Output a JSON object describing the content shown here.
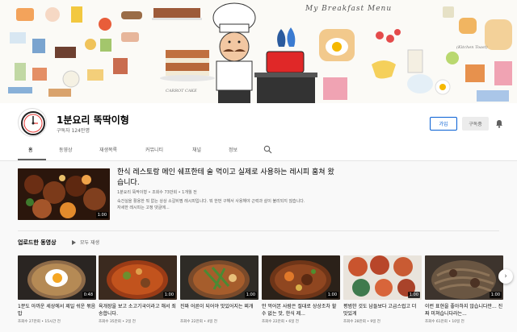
{
  "banner": {
    "headline": "My Breakfast Menu",
    "small_text_1": "(Kitchen Toast)",
    "small_text_2": "CARROT CAKE"
  },
  "channel": {
    "name": "1분요리 뚝딱이형",
    "subscribers": "구독자 124만명",
    "join_label": "가입",
    "subscribed_label": "구독중"
  },
  "tabs": [
    {
      "label": "홈",
      "active": true
    },
    {
      "label": "동영상",
      "active": false
    },
    {
      "label": "재생목록",
      "active": false
    },
    {
      "label": "커뮤니티",
      "active": false
    },
    {
      "label": "채널",
      "active": false
    },
    {
      "label": "정보",
      "active": false
    }
  ],
  "featured": {
    "title": "한식 레스토랑 메인 쉐프한테 술 먹이고 실제로 사용하는 레시피 훔쳐 왔습니다.",
    "meta": "1분요리 뚝딱이형 • 조회수 73만회 • 1개월 전",
    "desc_line1": "숙건실을 활용한 뭐 없는 상상 소갈비찜 레시피입니다. 뭐 한번 구해서 사용해야 근력과 살이 불리되지 않습니다.",
    "desc_line2": "자세한 레시피는 고정 댓글에...",
    "duration": "1:00"
  },
  "uploads": {
    "title": "업로드한 동영상",
    "play_all": "모두 재생"
  },
  "videos": [
    {
      "title": "1분도 아까운 세상에서 제일 쉬운 볶음밥",
      "meta": "조회수 27만회 • 15시간 전",
      "duration": "0:48"
    },
    {
      "title": "육개장을 보고 소고기국이라고 해서 죄송합니다.",
      "meta": "조회수 35만회 • 2일 전",
      "duration": "1:00"
    },
    {
      "title": "진짜 어른이 되어야 맛있어지는 찌개",
      "meta": "조회수 22만회 • 4일 전",
      "duration": "1:00"
    },
    {
      "title": "안 먹어본 사람은 절대로 상상조차 할 수 없는 맛, 한식 제...",
      "meta": "조회수 22만회 • 6일 전",
      "duration": "1:00"
    },
    {
      "title": "평범한 것도 남들보다 고급스럽고 더 맛있게",
      "meta": "조회수 28만회 • 9일 전",
      "duration": "1:00"
    },
    {
      "title": "이런 표현을 좋아하지 않습니다만... 진짜 미쳐습니다라는...",
      "meta": "조회수 61만회 • 10일 전",
      "duration": "1:00"
    }
  ],
  "colors": {
    "accent": "#065fd4",
    "text_primary": "#030303",
    "text_secondary": "#606060"
  }
}
